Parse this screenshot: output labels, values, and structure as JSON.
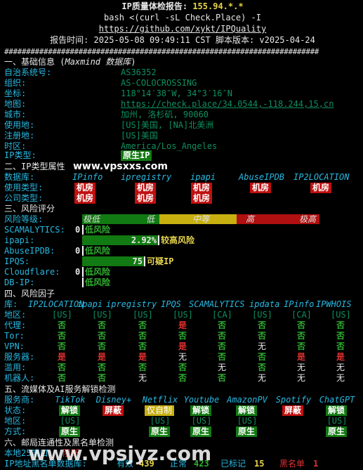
{
  "header": {
    "title_prefix": "IP质量体检报告: ",
    "title_ip": "155.94.*.*",
    "command": "bash <(curl -sL Check.Place) -I",
    "url": "https://github.com/xykt/IPQuality",
    "report_time": "报告时间: 2025-05-08 09:49:11 CST  脚本版本: v2025-04-24",
    "divider": "########################################################################"
  },
  "s1": {
    "title": "一、基础信息 (",
    "title_it": "Maxmind 数据库",
    "title_end": ")",
    "rows": [
      {
        "k": "自治系统号:",
        "v": "AS36352"
      },
      {
        "k": "组织:",
        "v": "AS-COLOCROSSING"
      },
      {
        "k": "坐标:",
        "v": "118°14′38″W, 34°3′16″N"
      },
      {
        "k": "地图:",
        "v": "https://check.place/34.0544,-118.244,15,cn"
      },
      {
        "k": "城市:",
        "v": "加州, 洛杉矶, 90060"
      },
      {
        "k": "使用地:",
        "v": "[US]美国, [NA]北美洲"
      },
      {
        "k": "注册地:",
        "v": "[US]美国"
      },
      {
        "k": "时区:",
        "v": "America/Los_Angeles"
      }
    ],
    "iptype_k": "IP类型:",
    "iptype_v": "原生IP"
  },
  "s2": {
    "title": "二、IP类型属性",
    "db_k": "数据库:",
    "dbs": [
      "IPinfo",
      "ipregistry",
      "ipapi",
      "AbuseIPDB",
      "IP2LOCATION"
    ],
    "use_k": "使用类型:",
    "use_v": [
      "机房",
      "机房",
      "机房",
      "机房",
      "机房"
    ],
    "co_k": "公司类型:",
    "co_v": [
      "机房",
      "机房",
      "机房"
    ]
  },
  "s3": {
    "title": "三、风险评分",
    "level_k": "风险等级:",
    "levels": [
      "极低",
      "低",
      "中等",
      "高",
      "极高"
    ],
    "rows": [
      {
        "k": "SCAMALYTICS:",
        "score": "0",
        "pct": 0,
        "label": "低风险"
      },
      {
        "k": "ipapi:",
        "score": "2.92%",
        "pct": 0.49,
        "label": "较高风险"
      },
      {
        "k": "AbuseIPDB:",
        "score": "0",
        "pct": 0,
        "label": "低风险"
      },
      {
        "k": "IPQS:",
        "score": "75",
        "pct": 0.4,
        "label": "可疑IP"
      },
      {
        "k": "Cloudflare:",
        "score": "0",
        "pct": 0,
        "label": "低风险"
      },
      {
        "k": "DB-IP:",
        "score": "",
        "pct": 0,
        "label": "低风险"
      }
    ]
  },
  "s4": {
    "title": "四、风险因子",
    "lib_k": "库:",
    "dbs": [
      "IP2LOCATION",
      "ipapi",
      "ipregistry",
      "IPQS",
      "SCAMALYTICS",
      "ipdata",
      "IPinfo",
      "IPWHOIS"
    ],
    "rows": [
      {
        "k": "地区:",
        "v": [
          "[US]",
          "[US]",
          "[US]",
          "[US]",
          "[CA]",
          "[US]",
          "[CA]",
          "[US]"
        ]
      },
      {
        "k": "代理:",
        "v": [
          "否",
          "否",
          "否",
          "是",
          "否",
          "否",
          "否",
          "否"
        ]
      },
      {
        "k": "Tor:",
        "v": [
          "否",
          "否",
          "否",
          "否",
          "否",
          "否",
          "否",
          "否"
        ]
      },
      {
        "k": "VPN:",
        "v": [
          "否",
          "否",
          "否",
          "是",
          "否",
          "无",
          "否",
          "否"
        ]
      },
      {
        "k": "服务器:",
        "v": [
          "是",
          "是",
          "是",
          "无",
          "否",
          "否",
          "是",
          "是"
        ]
      },
      {
        "k": "滥用:",
        "v": [
          "否",
          "否",
          "否",
          "否",
          "无",
          "否",
          "无",
          "无"
        ]
      },
      {
        "k": "机器人:",
        "v": [
          "否",
          "否",
          "无",
          "否",
          "否",
          "无",
          "无",
          "无"
        ]
      }
    ]
  },
  "s5": {
    "title": "五、流媒体及AI服务解锁检测",
    "svc_k": "服务商:",
    "services": [
      "TikTok",
      "Disney+",
      "Netflix",
      "Youtube",
      "AmazonPV",
      "Spotify",
      "ChatGPT"
    ],
    "status_k": "状态:",
    "status": [
      "解锁",
      "屏蔽",
      "仅自制",
      "解锁",
      "解锁",
      "屏蔽",
      "解锁"
    ],
    "region_k": "地区:",
    "region": [
      "[US]",
      "",
      "[US]",
      "[US]",
      "[US]",
      "",
      "[US]"
    ],
    "mode_k": "方式:",
    "mode": [
      "原生",
      "",
      "原生",
      "原生",
      "原生",
      "",
      "原生"
    ]
  },
  "s6": {
    "title": "六、邮局连通性及黑名单检测",
    "port_k": "本地25端口:",
    "port_v": "阻断",
    "bl_k": "IP地址黑名单数据库:",
    "bl_valid_k": "有效",
    "bl_valid": "439",
    "bl_ok_k": "正常",
    "bl_ok": "423",
    "bl_mark_k": "已标记",
    "bl_mark": "15",
    "bl_black_k": "黑名单",
    "bl_black": "1"
  },
  "watermarks": [
    "www.vpsxxs.com",
    "www.vpsjyz.com"
  ]
}
